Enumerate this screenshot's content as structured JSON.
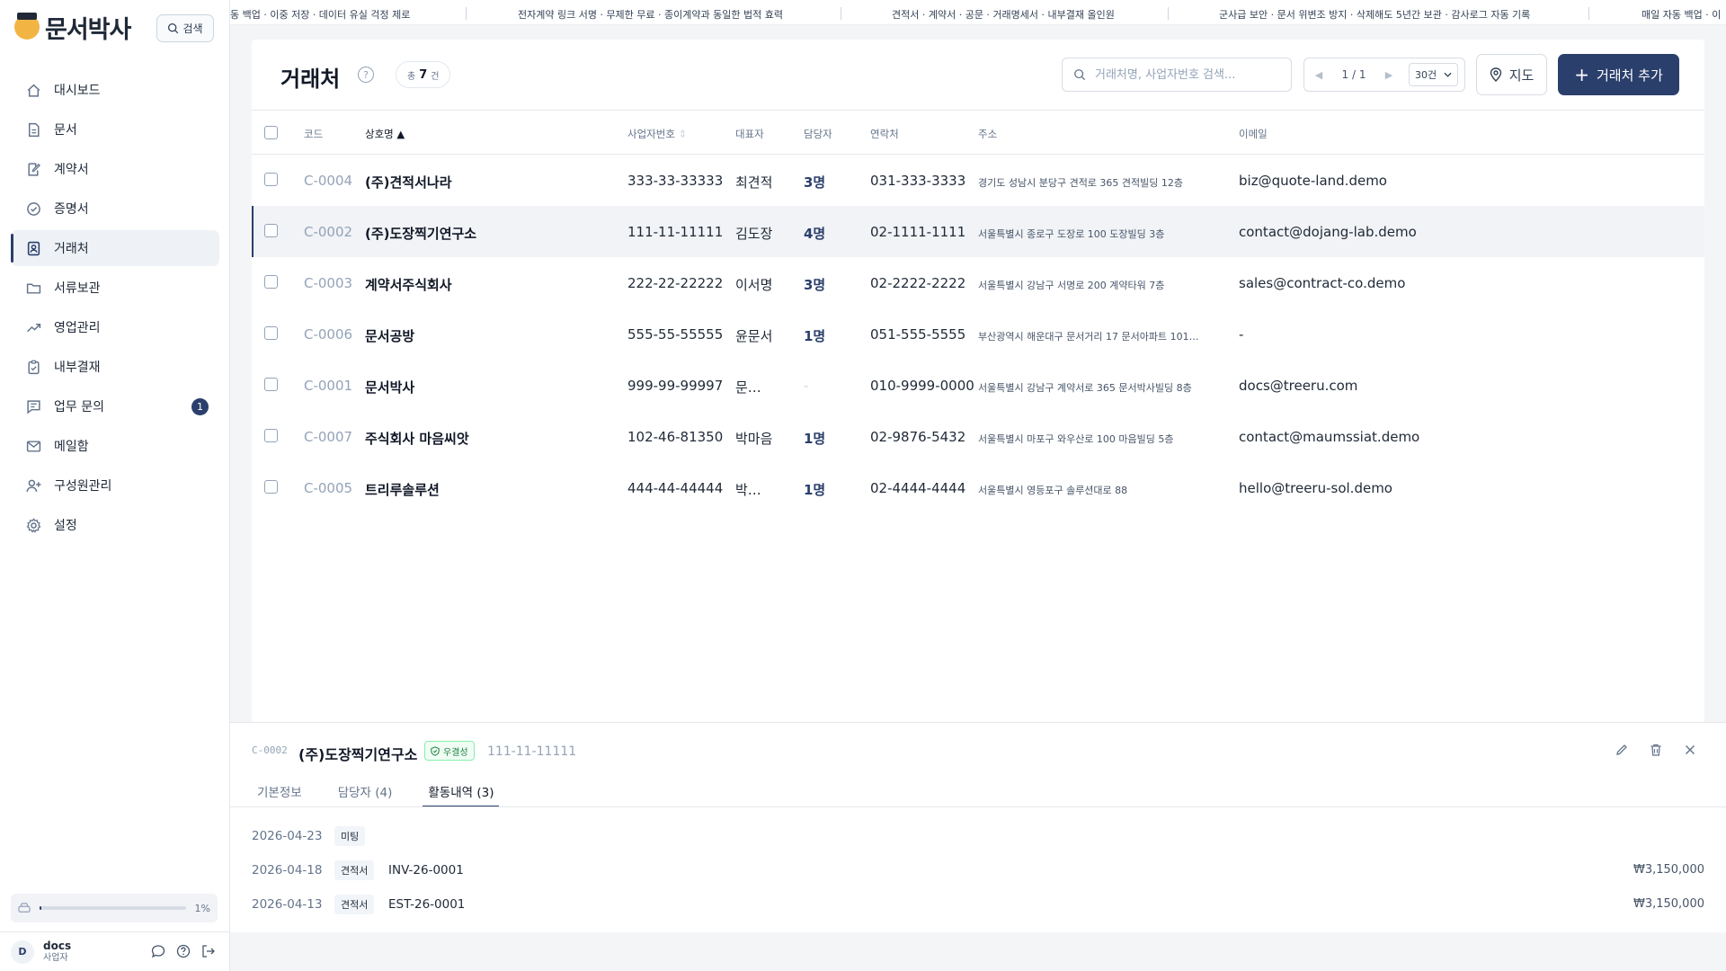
{
  "brand": {
    "name": "문서박사",
    "search_label": "검색"
  },
  "ticker": [
    "동 백업 · 이중 저장 · 데이터 유실 걱정 제로",
    "전자계약 링크 서명 · 무제한 무료 · 종이계약과 동일한 법적 효력",
    "견적서 · 계약서 · 공문 · 거래명세서 · 내부결재 올인원",
    "군사급 보안 · 문서 위변조 방지 · 삭제해도 5년간 보관 · 감사로그 자동 기록",
    "매일 자동 백업 · 이"
  ],
  "sidebar": {
    "items": [
      {
        "label": "대시보드",
        "icon": "home-icon"
      },
      {
        "label": "문서",
        "icon": "document-icon"
      },
      {
        "label": "계약서",
        "icon": "contract-icon"
      },
      {
        "label": "증명서",
        "icon": "certificate-icon"
      },
      {
        "label": "거래처",
        "icon": "contact-card-icon"
      },
      {
        "label": "서류보관",
        "icon": "folder-icon"
      },
      {
        "label": "영업관리",
        "icon": "trend-icon"
      },
      {
        "label": "내부결재",
        "icon": "clipboard-icon"
      },
      {
        "label": "업무 문의",
        "icon": "message-list-icon",
        "badge": "1"
      },
      {
        "label": "메일함",
        "icon": "mail-icon"
      },
      {
        "label": "구성원관리",
        "icon": "user-add-icon"
      },
      {
        "label": "설정",
        "icon": "gear-icon"
      }
    ],
    "active_index": 4,
    "storage": {
      "percent_label": "1%",
      "fraction": 0.01
    },
    "user": {
      "initial": "D",
      "name": "docs",
      "role": "사업자"
    }
  },
  "header": {
    "title": "거래처",
    "count_prefix": "총",
    "count": "7",
    "count_suffix": "건",
    "search_placeholder": "거래처명, 사업자번호 검색...",
    "page_info": "1 / 1",
    "page_size": "30건",
    "map_label": "지도",
    "add_label": "거래처 추가"
  },
  "table": {
    "columns": {
      "code": "코드",
      "name": "상호명",
      "name_sort": "▲",
      "biz": "사업자번호",
      "biz_sort": "⇕",
      "ceo": "대표자",
      "manager": "담당자",
      "tel": "연락처",
      "addr": "주소",
      "email": "이메일"
    },
    "rows": [
      {
        "code": "C-0004",
        "name": "(주)견적서나라",
        "biz": "333-33-33333",
        "ceo": "최견적",
        "manager": "3명",
        "tel": "031-333-3333",
        "addr": "경기도 성남시 분당구 견적로 365 견적빌딩 12층",
        "email": "biz@quote-land.demo"
      },
      {
        "code": "C-0002",
        "name": "(주)도장찍기연구소",
        "biz": "111-11-11111",
        "ceo": "김도장",
        "manager": "4명",
        "tel": "02-1111-1111",
        "addr": "서울특별시 종로구 도장로 100 도장빌딩 3층",
        "email": "contact@dojang-lab.demo"
      },
      {
        "code": "C-0003",
        "name": "계약서주식회사",
        "biz": "222-22-22222",
        "ceo": "이서명",
        "manager": "3명",
        "tel": "02-2222-2222",
        "addr": "서울특별시 강남구 서명로 200 계약타워 7층",
        "email": "sales@contract-co.demo"
      },
      {
        "code": "C-0006",
        "name": "문서공방",
        "biz": "555-55-55555",
        "ceo": "윤문서",
        "manager": "1명",
        "tel": "051-555-5555",
        "addr": "부산광역시 해운대구 문서거리 17 문서아파트 101…",
        "email": "-"
      },
      {
        "code": "C-0001",
        "name": "문서박사",
        "biz": "999-99-99997",
        "ceo": "문…",
        "manager": "-",
        "tel": "010-9999-0000",
        "addr": "서울특별시 강남구 계약서로 365 문서박사빌딩 8층",
        "email": "docs@treeru.com"
      },
      {
        "code": "C-0007",
        "name": "주식회사 마음씨앗",
        "biz": "102-46-81350",
        "ceo": "박마음",
        "manager": "1명",
        "tel": "02-9876-5432",
        "addr": "서울특별시 마포구 와우산로 100 마음빌딩 5층",
        "email": "contact@maumssiat.demo"
      },
      {
        "code": "C-0005",
        "name": "트리루솔루션",
        "biz": "444-44-44444",
        "ceo": "박…",
        "manager": "1명",
        "tel": "02-4444-4444",
        "addr": "서울특별시 영등포구 솔루션대로 88",
        "email": "hello@treeru-sol.demo"
      }
    ],
    "selected_index": 1
  },
  "detail": {
    "code": "C-0002",
    "name": "(주)도장찍기연구소",
    "badge": "우결성",
    "biz": "111-11-11111",
    "tabs": [
      {
        "label": "기본정보"
      },
      {
        "label": "담당자 (4)"
      },
      {
        "label": "활동내역 (3)"
      }
    ],
    "active_tab": 2,
    "activities": [
      {
        "date": "2026-04-23",
        "tag": "미팅",
        "ref": "",
        "amount": ""
      },
      {
        "date": "2026-04-18",
        "tag": "견적서",
        "ref": "INV-26-0001",
        "amount": "₩3,150,000"
      },
      {
        "date": "2026-04-13",
        "tag": "견적서",
        "ref": "EST-26-0001",
        "amount": "₩3,150,000"
      }
    ]
  },
  "colors": {
    "accent": "#2b3f6c",
    "success": "#15803d"
  }
}
